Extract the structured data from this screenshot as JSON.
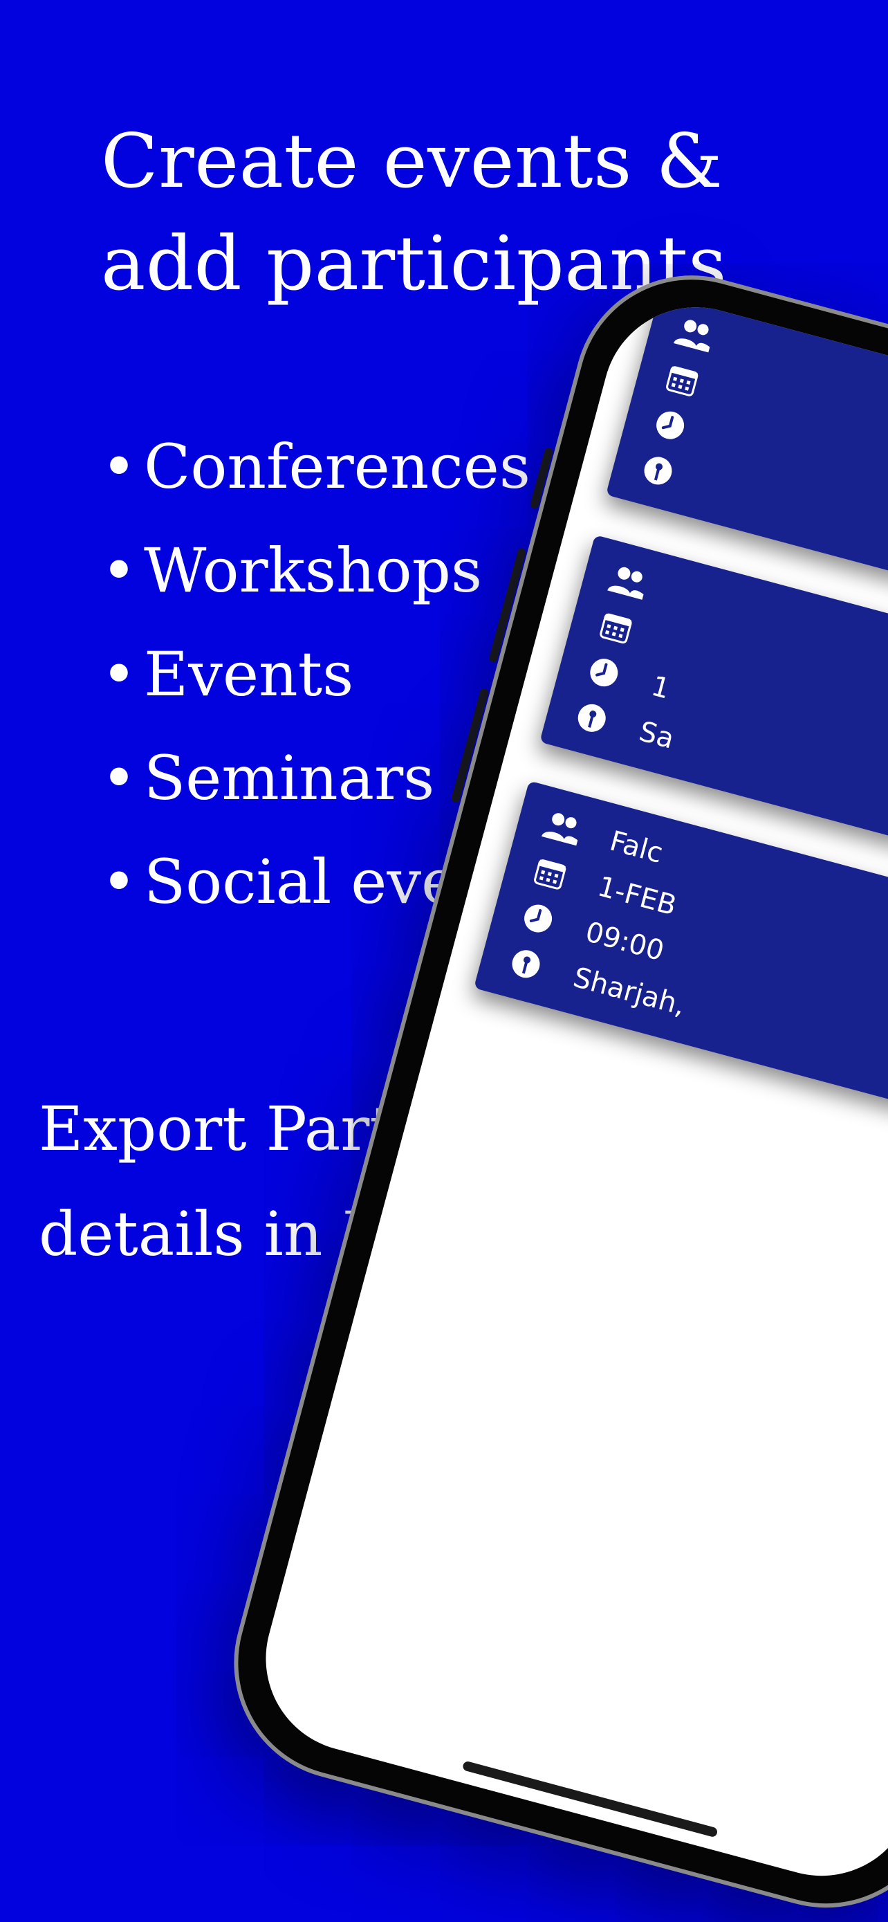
{
  "headline": {
    "line1": "Create events &",
    "line2": "add participants"
  },
  "feature_bullet": "•",
  "features": [
    "Conferences",
    "Workshops",
    "Events",
    "Seminars",
    "Social events"
  ],
  "export": {
    "line1": "Export Participant",
    "line2": "details in Excel"
  },
  "phone": {
    "cards": [
      {
        "name_partial": "",
        "date_partial": "",
        "time_partial": "",
        "location_partial": ""
      },
      {
        "name_partial": "",
        "date_partial": "",
        "time_partial": "1",
        "location_partial": "Sa"
      },
      {
        "name_partial": "Falc",
        "date_partial": "1-FEB",
        "time_partial": "09:00",
        "location_partial": "Sharjah,"
      }
    ],
    "icons": [
      "people-icon",
      "calendar-icon",
      "clock-icon",
      "location-pin-icon"
    ]
  },
  "colors": {
    "background": "#0202de",
    "card": "#17228f",
    "text": "#ffffff",
    "screen": "#ffffff",
    "frame": "#050505"
  }
}
